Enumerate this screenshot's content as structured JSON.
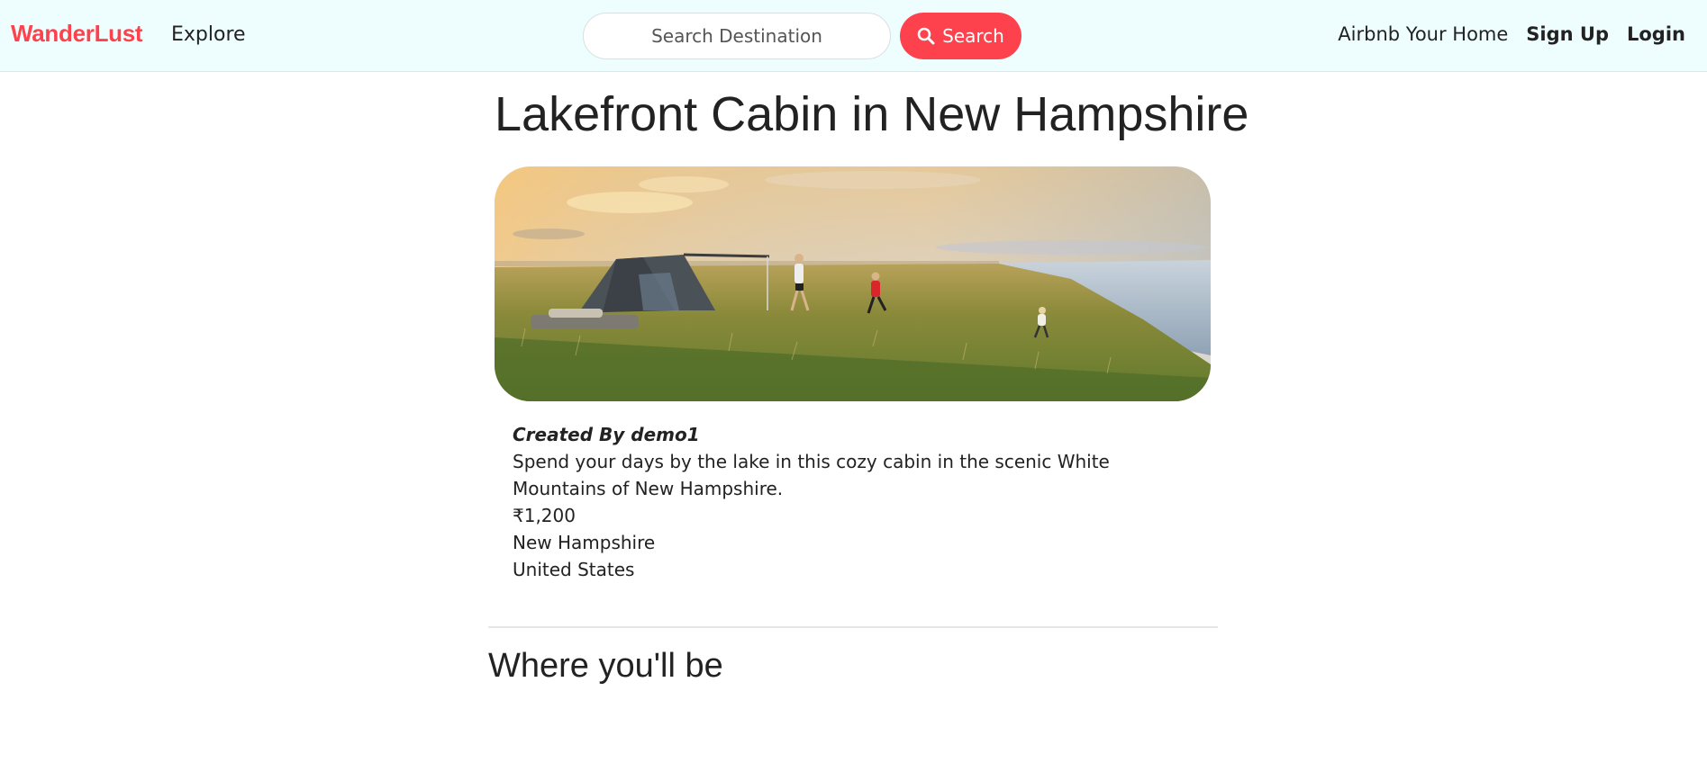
{
  "navbar": {
    "brand": "WanderLust",
    "explore": "Explore",
    "search": {
      "placeholder": "Search Destination",
      "button_label": "Search"
    },
    "right_links": {
      "host": "Airbnb Your Home",
      "signup": "Sign Up",
      "login": "Login"
    },
    "icons": {
      "search": "search-icon"
    }
  },
  "listing": {
    "title": "Lakefront Cabin in New Hampshire",
    "image_alt_icon": "camping-landscape-image",
    "created_by": "Created By demo1",
    "description": "Spend your days by the lake in this cozy cabin in the scenic White Mountains of New Hampshire.",
    "price": "₹1,200",
    "location": "New Hampshire",
    "country": "United States"
  },
  "map_section": {
    "heading": "Where you'll be"
  },
  "colors": {
    "brand": "#fe424d",
    "navbar_bg": "#eefefe",
    "text": "#222222"
  }
}
